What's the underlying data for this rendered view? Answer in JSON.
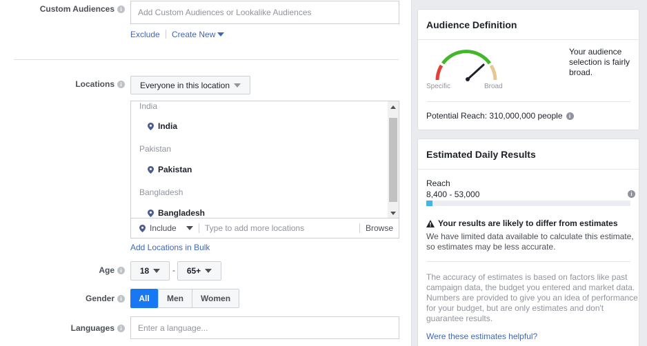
{
  "targeting": {
    "custom_audiences": {
      "label": "Custom Audiences",
      "placeholder": "Add Custom Audiences or Lookalike Audiences",
      "exclude_link": "Exclude",
      "create_new_link": "Create New"
    },
    "locations": {
      "label": "Locations",
      "dropdown_value": "Everyone in this location",
      "groups": [
        {
          "group": "India",
          "item": "India"
        },
        {
          "group": "Pakistan",
          "item": "Pakistan"
        },
        {
          "group": "Bangladesh",
          "item": "Bangladesh"
        }
      ],
      "include_label": "Include",
      "search_placeholder": "Type to add more locations",
      "browse_label": "Browse",
      "bulk_link": "Add Locations in Bulk"
    },
    "age": {
      "label": "Age",
      "min": "18",
      "separator": "-",
      "max": "65+"
    },
    "gender": {
      "label": "Gender",
      "options": [
        "All",
        "Men",
        "Women"
      ],
      "selected": "All"
    },
    "languages": {
      "label": "Languages",
      "placeholder": "Enter a language..."
    }
  },
  "audience_definition": {
    "title": "Audience Definition",
    "gauge_specific": "Specific",
    "gauge_broad": "Broad",
    "description": "Your audience selection is fairly broad.",
    "potential_reach": "Potential Reach: 310,000,000 people"
  },
  "estimated_results": {
    "title": "Estimated Daily Results",
    "reach_label": "Reach",
    "reach_value": "8,400 - 53,000",
    "reach_fill": 0.03,
    "warning_title": "Your results are likely to differ from estimates",
    "warning_text": "We have limited data available to calculate this estimate, so estimates may be less accurate.",
    "accuracy_text": "The accuracy of estimates is based on factors like past campaign data, the budget you entered and market data. Numbers are provided to give you an idea of performance for your budget, but are only estimates and don't guarantee results.",
    "helpful_link": "Were these estimates helpful?"
  },
  "colors": {
    "accent": "#4267b2",
    "selected": "#1877f2",
    "progress": "#4ab3e6",
    "gauge_green": "#42b72a",
    "gauge_red": "#e04035",
    "gauge_tan": "#e8c68d"
  }
}
